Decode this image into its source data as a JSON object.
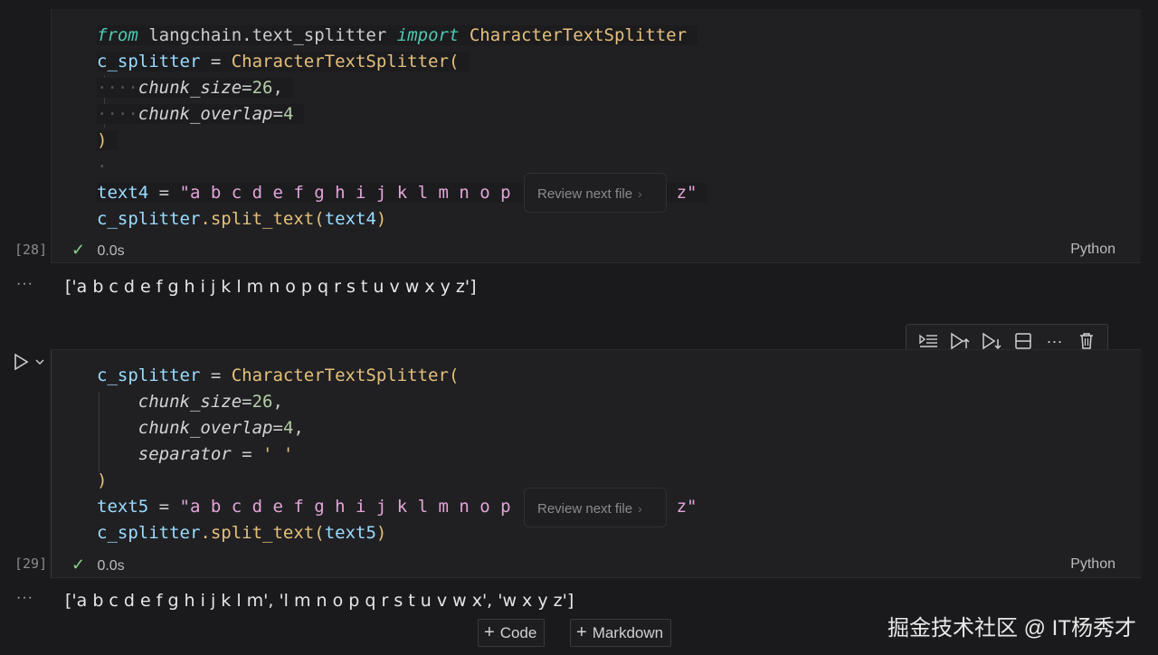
{
  "cell1": {
    "code_lines": [
      {
        "kw1": "from",
        "mod": " langchain.text_splitter ",
        "kw2": "import",
        "cls": " CharacterTextSplitter"
      },
      {
        "var": "c_splitter",
        "op": " = ",
        "cls": "CharacterTextSplitter",
        "par": "("
      },
      {
        "arg": "chunk_size",
        "op": "=",
        "num": "26",
        "tail": ","
      },
      {
        "arg": "chunk_overlap",
        "op": "=",
        "num": "4",
        "tail": ""
      },
      {
        "par": ")"
      },
      {
        "var": "text4",
        "op": " = ",
        "str": "\"a b c d e f g h i j k l m n o p",
        "str_end": " x y z\""
      },
      {
        "var": "c_splitter",
        "fn": ".split_text",
        "par": "(",
        "argv": "text4",
        "par2": ")"
      }
    ],
    "exec_count": "[28]",
    "status_time": "0.0s",
    "language": "Python",
    "hint": "Review next file",
    "output": "['a b c d e f g h i j k l m n o p q r s t u v w x y z']"
  },
  "cell2": {
    "code_lines": [
      {
        "var": "c_splitter",
        "op": " = ",
        "cls": "CharacterTextSplitter",
        "par": "("
      },
      {
        "arg": "chunk_size",
        "op": "=",
        "num": "26",
        "tail": ","
      },
      {
        "arg": "chunk_overlap",
        "op": "=",
        "num": "4",
        "tail": ","
      },
      {
        "arg": "separator",
        "op": " = ",
        "str": "' '"
      },
      {
        "par": ")"
      },
      {
        "var": "text5",
        "op": " = ",
        "str": "\"a b c d e f g h i j k l m n o p",
        "str_end": " x y z\""
      },
      {
        "var": "c_splitter",
        "fn": ".split_text",
        "par": "(",
        "argv": "text5",
        "par2": ")"
      }
    ],
    "exec_count": "[29]",
    "status_time": "0.0s",
    "language": "Python",
    "hint": "Review next file",
    "output": "['a b c d e f g h i j k l m', 'l m n o p q r s t u v w x', 'w x y z']"
  },
  "output_prefix": "···",
  "add_buttons": {
    "code": "Code",
    "markdown": "Markdown"
  },
  "watermark": "掘金技术社区 @ IT杨秀才"
}
